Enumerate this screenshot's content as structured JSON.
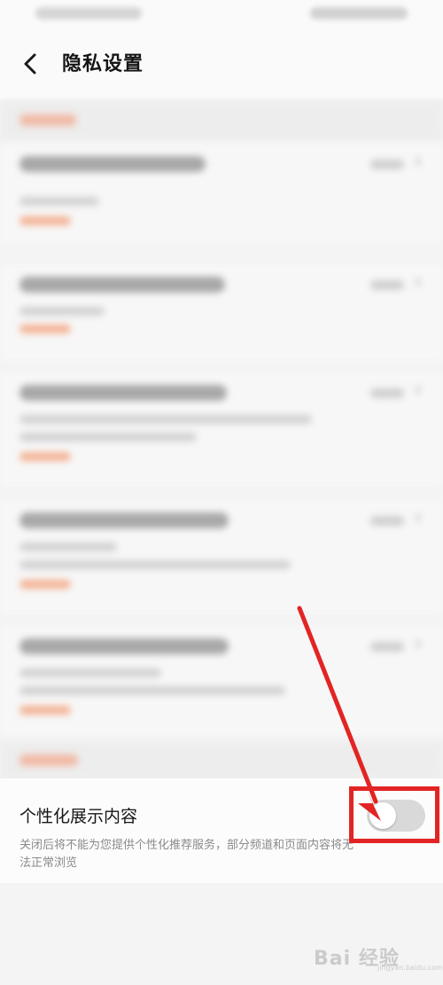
{
  "header": {
    "title": "隐私设置",
    "back_icon": "back-chevron-icon"
  },
  "personalization": {
    "title": "个性化展示内容",
    "description": "关闭后将不能为您提供个性化推荐服务，部分频道和页面内容将无法正常浏览",
    "toggle_on": false
  },
  "watermark": {
    "text": "Bai 经验",
    "sub": "jingyan.baidu.com"
  },
  "colors": {
    "annotation_red": "#e32424",
    "link_orange": "#f3b294"
  }
}
